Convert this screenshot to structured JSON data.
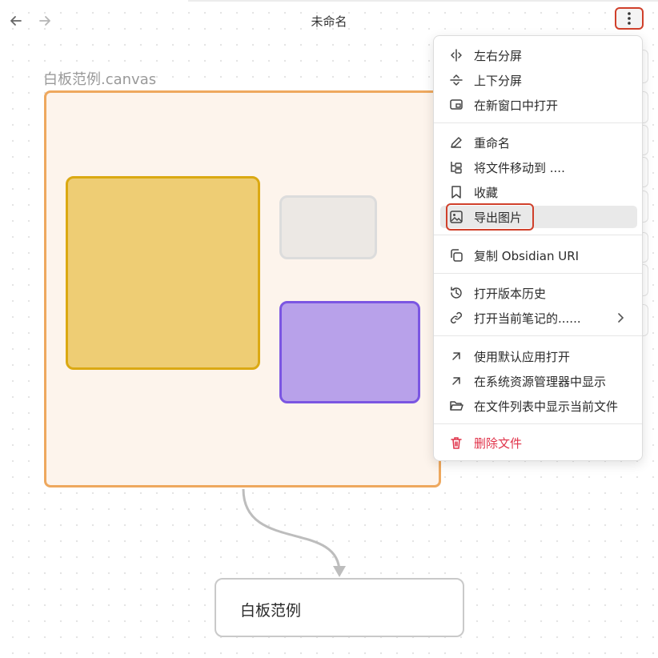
{
  "header": {
    "title": "未命名",
    "back_icon": "arrow-left-icon",
    "forward_icon": "arrow-right-icon",
    "more_icon": "vertical-dots-icon"
  },
  "canvas": {
    "group_label": "白板范例.canvas",
    "note_text": "白板范例"
  },
  "menu": {
    "items": [
      {
        "label": "左右分屏",
        "icon": "split-vertical-icon"
      },
      {
        "label": "上下分屏",
        "icon": "split-horizontal-icon"
      },
      {
        "label": "在新窗口中打开",
        "icon": "new-window-icon"
      },
      {
        "label": "重命名",
        "icon": "pencil-icon"
      },
      {
        "label": "将文件移动到 ....",
        "icon": "folder-tree-icon"
      },
      {
        "label": "收藏",
        "icon": "bookmark-icon"
      },
      {
        "label": "导出图片",
        "icon": "image-icon"
      },
      {
        "label": "复制 Obsidian URI",
        "icon": "copy-icon"
      },
      {
        "label": "打开版本历史",
        "icon": "history-icon"
      },
      {
        "label": "打开当前笔记的......",
        "icon": "link-icon"
      },
      {
        "label": "使用默认应用打开",
        "icon": "arrow-up-right-icon"
      },
      {
        "label": "在系统资源管理器中显示",
        "icon": "arrow-up-right-icon"
      },
      {
        "label": "在文件列表中显示当前文件",
        "icon": "folder-open-icon"
      },
      {
        "label": "删除文件",
        "icon": "trash-icon"
      }
    ]
  },
  "colors": {
    "annotation_red": "#d0402b",
    "group_border": "#eea85e",
    "yellow_card": "#eecd74",
    "purple_card": "#b8a1ea",
    "danger": "#e0334a"
  }
}
